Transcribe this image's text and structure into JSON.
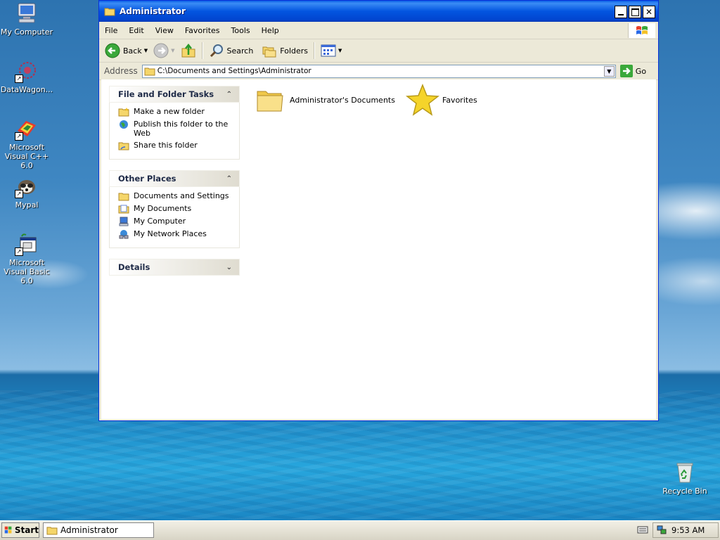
{
  "desktop": {
    "icons": [
      {
        "label": "My Computer"
      },
      {
        "label": "DataWagon..."
      },
      {
        "label": "Microsoft Visual C++ 6.0"
      },
      {
        "label": "Mypal"
      },
      {
        "label": "Microsoft Visual Basic 6.0"
      },
      {
        "label": "Recycle Bin"
      }
    ]
  },
  "window": {
    "title": "Administrator",
    "menu": [
      "File",
      "Edit",
      "View",
      "Favorites",
      "Tools",
      "Help"
    ],
    "toolbar": {
      "back_label": "Back",
      "search_label": "Search",
      "folders_label": "Folders"
    },
    "address": {
      "label": "Address",
      "value": "C:\\Documents and Settings\\Administrator",
      "go_label": "Go"
    },
    "taskpane": {
      "file_tasks": {
        "title": "File and Folder Tasks",
        "items": [
          "Make a new folder",
          "Publish this folder to the Web",
          "Share this folder"
        ]
      },
      "other_places": {
        "title": "Other Places",
        "items": [
          "Documents and Settings",
          "My Documents",
          "My Computer",
          "My Network Places"
        ]
      },
      "details": {
        "title": "Details"
      }
    },
    "files": [
      {
        "name": "Administrator's Documents",
        "icon": "folder-icon"
      },
      {
        "name": "Favorites",
        "icon": "star-icon"
      }
    ]
  },
  "taskbar": {
    "start_label": "Start",
    "task_label": "Administrator",
    "clock": "9:53 AM"
  }
}
